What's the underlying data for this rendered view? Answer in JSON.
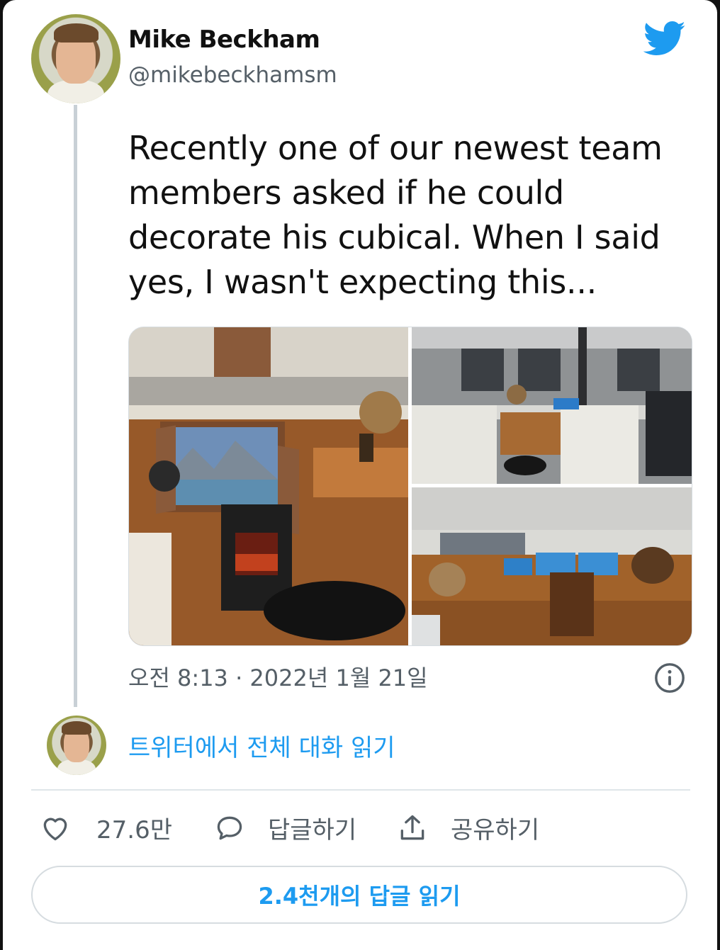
{
  "author": {
    "name": "Mike Beckham",
    "handle": "@mikebeckhamsm"
  },
  "tweet": {
    "text": "Recently one of our newest team members asked if he could decorate his cubical. When I said yes, I wasn't expecting this...",
    "timestamp": "오전 8:13 · 2022년 1월 21일",
    "photos": [
      "cubicle-window-fireplace",
      "cubicle-wide-office-view",
      "cubicle-desk-monitors"
    ]
  },
  "read_conversation_label": "트위터에서 전체 대화 읽기",
  "actions": {
    "like_count": "27.6만",
    "reply_label": "답글하기",
    "share_label": "공유하기"
  },
  "read_replies_label": "2.4천개의 답글 읽기",
  "colors": {
    "accent": "#1d9bf0",
    "secondary_text": "#555f67",
    "thread_line": "#c8d0d6"
  },
  "icons": [
    "twitter-bird-icon",
    "info-icon",
    "heart-icon",
    "reply-icon",
    "share-icon"
  ]
}
